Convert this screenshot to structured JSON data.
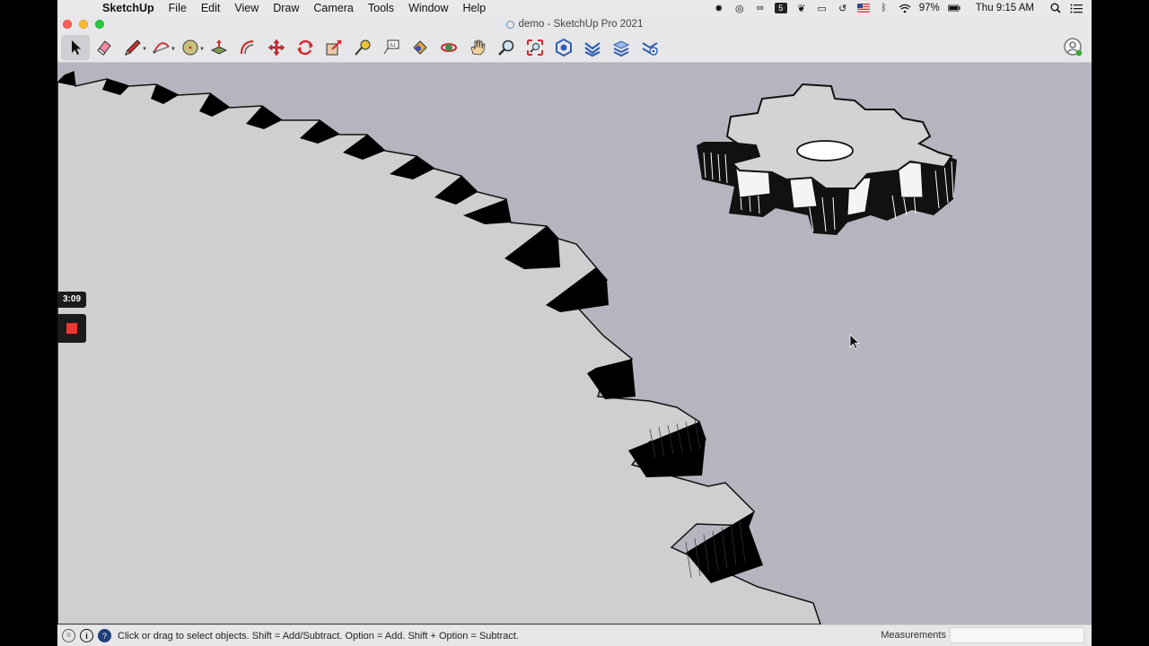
{
  "menubar": {
    "app_name": "SketchUp",
    "items": [
      "File",
      "Edit",
      "View",
      "Draw",
      "Camera",
      "Tools",
      "Window",
      "Help"
    ],
    "status_icons": [
      "gear-icon",
      "creative-cloud-icon",
      "link-icon",
      "five-icon",
      "evernote-icon",
      "airplay-icon",
      "time-machine-icon",
      "us-flag-icon",
      "bluetooth-icon",
      "wifi-icon"
    ],
    "battery": "97%",
    "clock": "Thu 9:15 AM"
  },
  "window": {
    "title": "demo - SketchUp Pro 2021"
  },
  "toolbar": {
    "tools": [
      "select-tool",
      "eraser-tool",
      "line-tool",
      "arc-tool",
      "shapes-tool",
      "push-pull-tool",
      "offset-tool",
      "move-tool",
      "rotate-tool",
      "scale-tool",
      "tape-measure-tool",
      "text-tool",
      "paint-bucket-tool",
      "orbit-tool",
      "pan-tool",
      "zoom-tool",
      "zoom-extents-tool",
      "3d-warehouse-tool",
      "extension-warehouse-tool",
      "layout-tool",
      "extension-manager-tool"
    ]
  },
  "recording": {
    "timer": "3:09"
  },
  "statusbar": {
    "hint": "Click or drag to select objects. Shift = Add/Subtract. Option = Add. Shift + Option = Subtract.",
    "measurements_label": "Measurements",
    "measurements_value": ""
  },
  "colors": {
    "viewport_bg": "#b6b5bf",
    "gear_face": "#cfcfcf",
    "chrome": "#e7e6e8",
    "record_red": "#e8372d"
  }
}
